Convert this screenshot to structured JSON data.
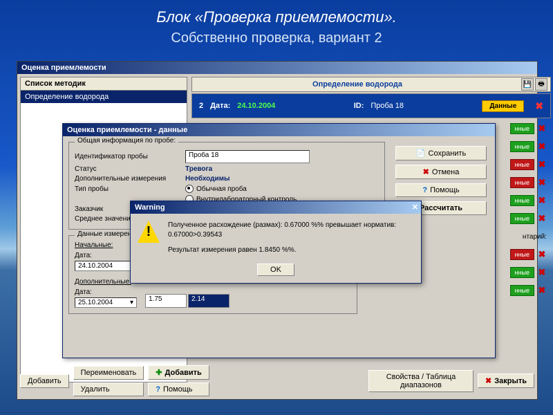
{
  "slide": {
    "title": "Блок «Проверка приемлемости».",
    "subtitle": "Собственно проверка, вариант 2"
  },
  "main": {
    "title": "Оценка приемлемости"
  },
  "sidebar": {
    "header": "Список методик",
    "item": "Определение водорода"
  },
  "panel": {
    "header": "Определение водорода",
    "date_lbl": "Дата:",
    "date_val": "24.10.2004",
    "id_lbl": "ID:",
    "id_val": "Проба 18",
    "data_btn": "Данные"
  },
  "rows": {
    "green": "нные",
    "red": "нные",
    "comment": "нтарий:"
  },
  "bottom": {
    "add": "Добавить",
    "rename": "Переименовать",
    "delete": "Удалить",
    "add2": "Добавить",
    "help": "Помощь",
    "props": "Свойства / Таблица диапазонов",
    "close": "Закрыть"
  },
  "sub": {
    "title": "Оценка приемлемости - данные",
    "group1": "Общая информация по пробе:",
    "id_lbl": "Идентификатор пробы",
    "id_val": "Проба 18",
    "status_lbl": "Статус",
    "status_val": "Тревога",
    "extra_lbl": "Дополнительные измерения",
    "extra_val": "Необходимы",
    "type_lbl": "Тип пробы",
    "type_opt1": "Обычная проба",
    "type_opt2": "Внутрилабораторный контроль",
    "customer_lbl": "Заказчик",
    "mean_lbl": "Среднее значени",
    "btn_save": "Сохранить",
    "btn_cancel": "Отмена",
    "btn_help": "Помощь",
    "btn_calc": "Рассчитать",
    "meas_legend": "Данные измерени",
    "initial": "Начальные:",
    "additional": "Дополнительные:",
    "date_lbl": "Дата:",
    "date1": "24.10.2004",
    "date2": "25.10.2004",
    "v1": "1.75",
    "v2": "2.14"
  },
  "warn": {
    "title": "Warning",
    "line1": "Полученное расхождение (размах): 0.67000 %% превышает норматив:",
    "line2": "0.67000>0.39543",
    "line3": "Результат измерения равен 1.8450 %%.",
    "ok": "OK"
  }
}
